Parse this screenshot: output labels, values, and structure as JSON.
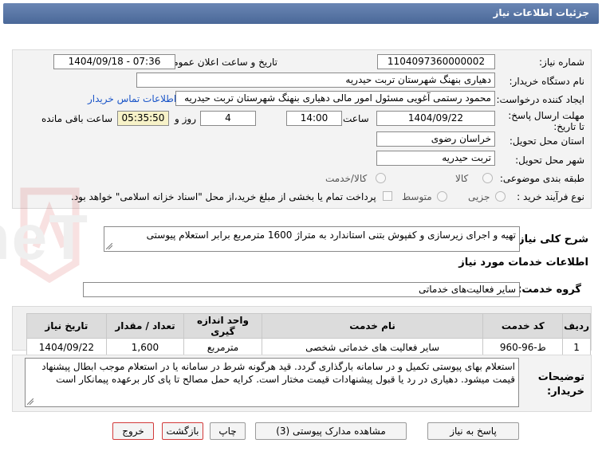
{
  "header": {
    "title": "جزئیات اطلاعات نیاز"
  },
  "form": {
    "need_number_label": "شماره نیاز:",
    "need_number": "1104097360000002",
    "announce_label": "تاریخ و ساعت اعلان عمومی:",
    "announce_value": "1404/09/18 - 07:36",
    "buyer_org_label": "نام دستگاه خریدار:",
    "buyer_org": "دهیاری بنهنگ  شهرستان تربت حیدریه",
    "requester_label": "ایجاد کننده درخواست:",
    "requester": "محمود رستمی آغویی مسئول امور مالی  دهیاری بنهنگ  شهرستان تربت حیدریه",
    "contact_link": "اطلاعات تماس خریدار",
    "deadline_label": "مهلت ارسال پاسخ: تا تاریخ:",
    "deadline_date": "1404/09/22",
    "time_label": "ساعت",
    "deadline_time": "14:00",
    "days_value": "4",
    "days_label": "روز و",
    "remaining_time": "05:35:50",
    "remaining_label": "ساعت باقی مانده",
    "province_label": "استان محل تحویل:",
    "province": "خراسان رضوی",
    "city_label": "شهر محل تحویل:",
    "city": "تربت حیدریه",
    "category_label": "طبقه بندی موضوعی:",
    "category_options": [
      "کالا",
      "کالا/خدمت"
    ],
    "purchase_type_label": "نوع فرآیند خرید :",
    "purchase_type_options": [
      "جزیی",
      "متوسط"
    ],
    "payment_note": "پرداخت تمام یا بخشی از مبلغ خرید،از محل \"اسناد خزانه اسلامی\" خواهد بود."
  },
  "description": {
    "label": "شرح کلی نیاز:",
    "text": "تهیه و اجرای زیرسازی و کفپوش بتنی استاندارد به متراژ 1600 مترمربع برابر استعلام پیوستی"
  },
  "services": {
    "section_title": "اطلاعات خدمات مورد نیاز",
    "group_label": "گروه خدمت:",
    "group_value": "سایر فعالیت‌های خدماتی",
    "table_headers": [
      "ردیف",
      "کد خدمت",
      "نام خدمت",
      "واحد اندازه گیری",
      "تعداد / مقدار",
      "تاریخ نیاز"
    ],
    "rows": [
      [
        "1",
        "ط-96-960",
        "سایر فعالیت های خدماتی شخصی",
        "مترمربع",
        "1,600",
        "1404/09/22"
      ]
    ]
  },
  "buyer_notes": {
    "label_line1": "توضیحات",
    "label_line2": "خریدار:",
    "text": "استعلام بهای پیوستی تکمیل و در سامانه بارگذاری گردد. قید هرگونه شرط در سامانه یا در استعلام موجب ابطال پیشنهاد قیمت میشود. دهیاری در رد یا قبول پیشنهادات قیمت مختار است. کرایه حمل مصالح تا پای کار برعهده پیمانکار است"
  },
  "buttons": {
    "reply": "پاسخ به نیاز",
    "attachments": "مشاهده مدارک پیوستی (3)",
    "print": "چاپ",
    "back": "بازگشت",
    "exit": "خروج"
  },
  "watermark": {
    "text": "AriaTender.neT"
  },
  "colors": {
    "header": "#5674a6",
    "link": "#1a55c8",
    "button_border_red": "#d23a3a"
  }
}
